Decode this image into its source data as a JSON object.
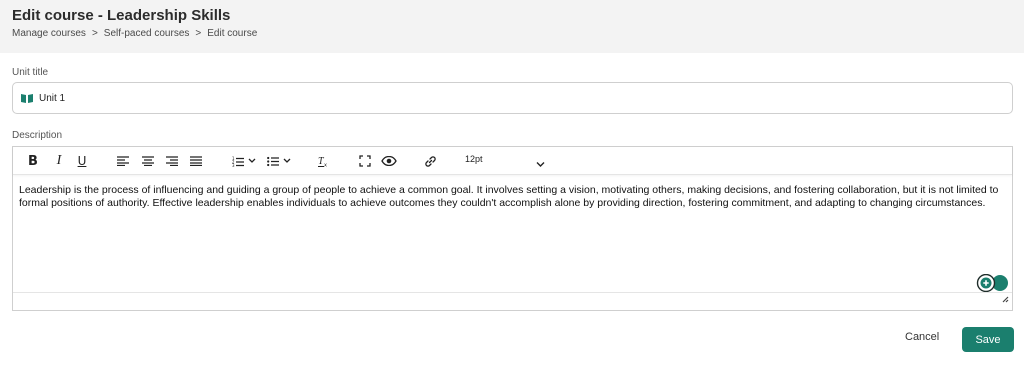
{
  "header": {
    "title": "Edit course - Leadership Skills",
    "breadcrumb": [
      "Manage courses",
      ">",
      "Self-paced courses",
      ">",
      "Edit course"
    ]
  },
  "unit": {
    "label": "Unit title",
    "value": "Unit 1",
    "icon": "book-icon",
    "icon_color": "#1b7f6e"
  },
  "description": {
    "label": "Description",
    "toolbar": {
      "bold": "B",
      "italic": "I",
      "underline": "U",
      "font_size": "12pt"
    },
    "content": "Leadership is the process of influencing and guiding a group of people to achieve a common goal. It involves setting a vision, motivating others, making decisions, and fostering collaboration, but it is not limited to formal positions of authority. Effective leadership enables individuals to achieve outcomes they couldn't accomplish alone by providing direction, fostering commitment, and adapting to changing circumstances."
  },
  "actions": {
    "cancel": "Cancel",
    "save": "Save"
  },
  "colors": {
    "accent": "#1b7f6e",
    "header_bg": "#f3f3f3"
  }
}
